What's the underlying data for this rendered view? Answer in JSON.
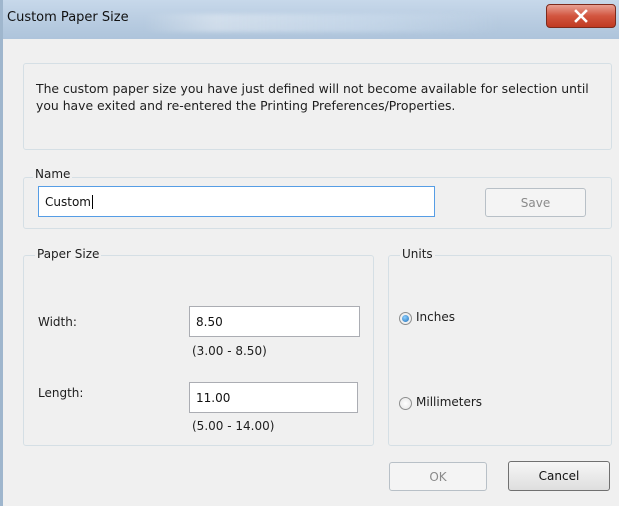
{
  "window": {
    "title": "Custom Paper Size",
    "close_icon": "close-icon"
  },
  "info": {
    "message": "The custom paper size you have just defined will not become available for selection until you have exited and re-entered the Printing Preferences/Properties."
  },
  "name_group": {
    "legend": "Name",
    "value": "Custom",
    "save_label": "Save",
    "save_enabled": false
  },
  "paper_size": {
    "legend": "Paper Size",
    "width_label": "Width:",
    "width_value": "8.50",
    "width_range": "(3.00 - 8.50)",
    "length_label": "Length:",
    "length_value": "11.00",
    "length_range": "(5.00 - 14.00)"
  },
  "units": {
    "legend": "Units",
    "options": [
      {
        "label": "Inches",
        "selected": true
      },
      {
        "label": "Millimeters",
        "selected": false
      }
    ]
  },
  "footer": {
    "ok_label": "OK",
    "ok_enabled": false,
    "cancel_label": "Cancel"
  },
  "colors": {
    "title_bar": "#b7cbe0",
    "close_button": "#d2553f",
    "focus_border": "#569de5"
  }
}
